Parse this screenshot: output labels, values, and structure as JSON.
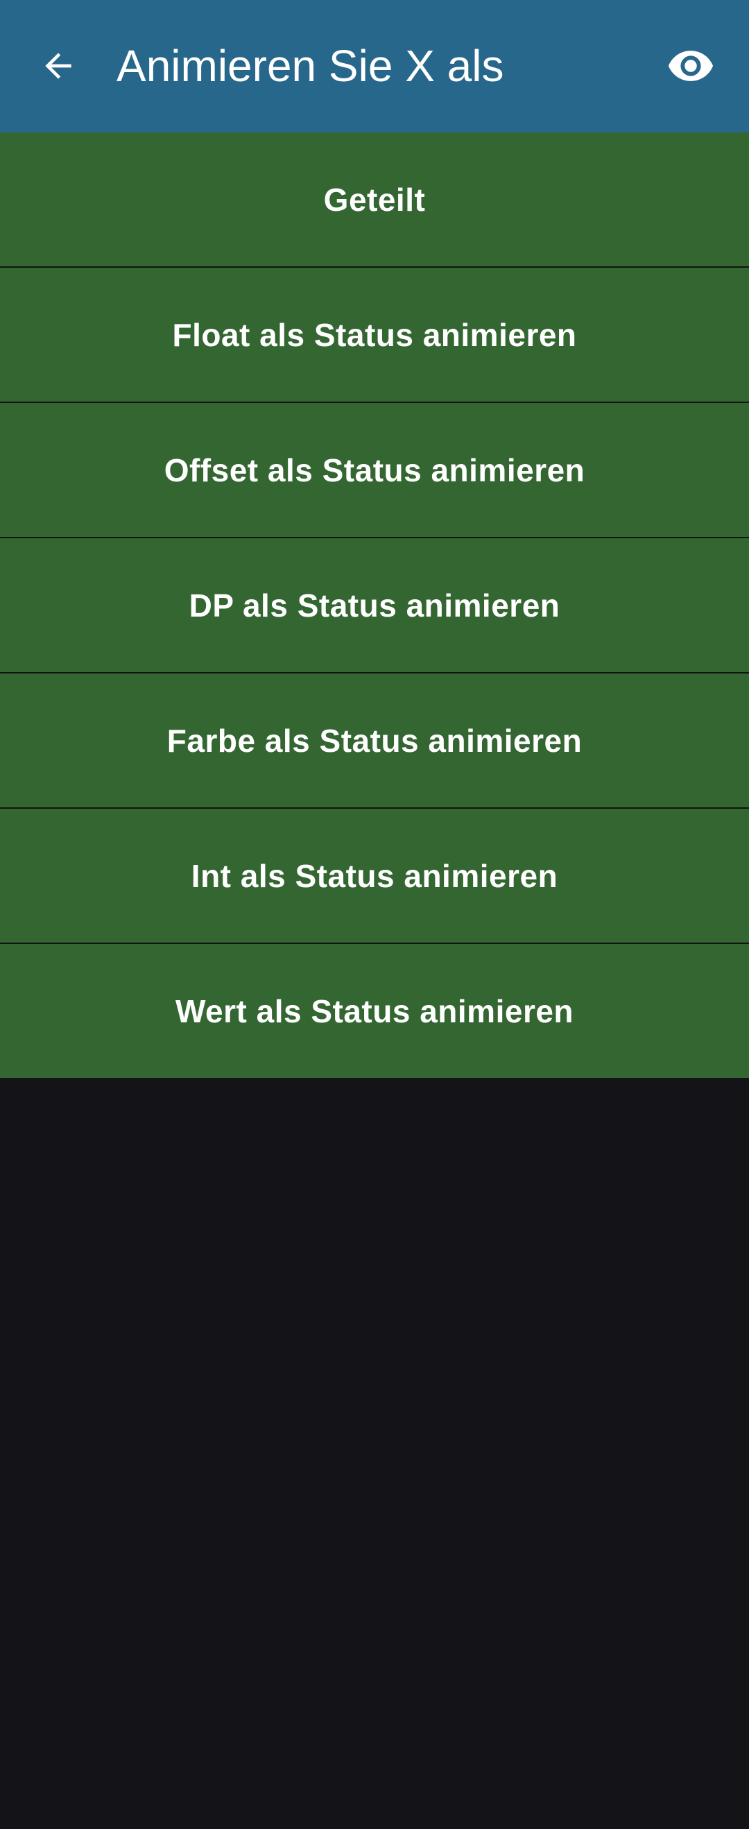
{
  "header": {
    "title": "Animieren Sie X als",
    "back_icon": "arrow-left-icon",
    "action_icon": "eye-icon"
  },
  "menu": {
    "items": [
      {
        "label": "Geteilt"
      },
      {
        "label": "Float als Status animieren"
      },
      {
        "label": "Offset als Status animieren"
      },
      {
        "label": "DP als Status animieren"
      },
      {
        "label": "Farbe als Status animieren"
      },
      {
        "label": "Int als Status animieren"
      },
      {
        "label": "Wert als Status animieren"
      }
    ]
  },
  "colors": {
    "app_bar": "#28678c",
    "menu_item": "#346632",
    "background": "#141318",
    "text": "#ffffff"
  }
}
